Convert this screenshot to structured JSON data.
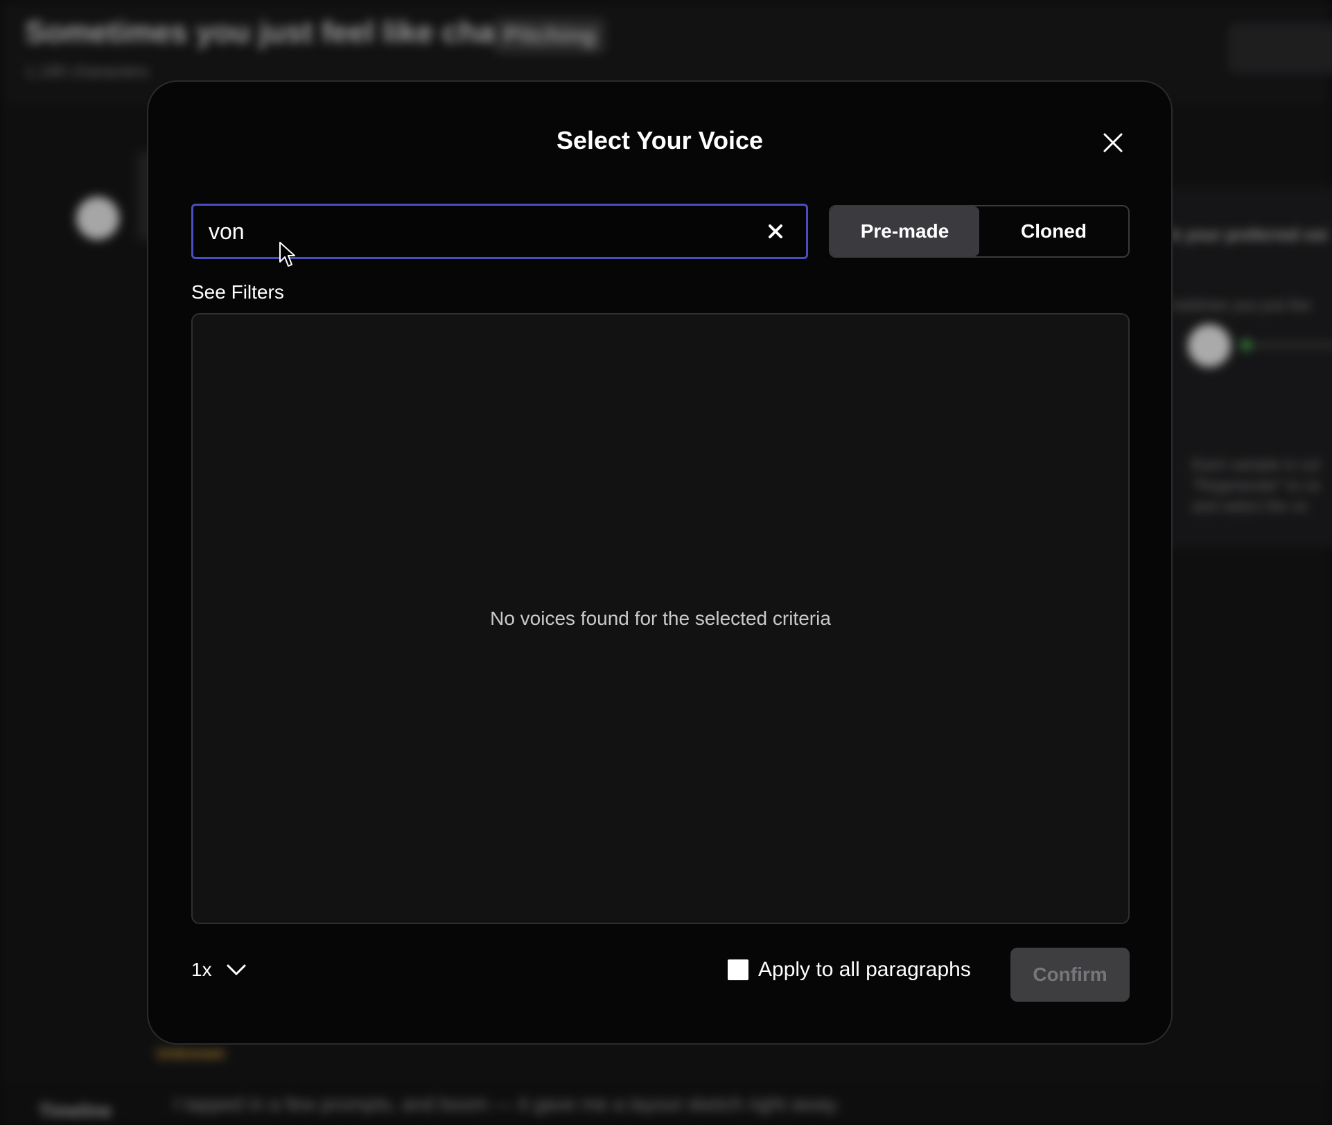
{
  "background": {
    "title": "Sometimes you just feel like cha...",
    "badge": "Pitching",
    "subtitle": "1,180 characters",
    "right_panel_title": "k your preferred voi",
    "right_panel_sub": "metimes you just fee",
    "right_panel_note": "Each sample is cut \"Regenerate\" to ca and select the vo",
    "unknown_label": "Unknown",
    "timeline_label": "Timeline",
    "bottom_text": "I tapped in a few prompts, and boom — it gave me a layout sketch right away."
  },
  "modal": {
    "title": "Select Your Voice",
    "search": {
      "value": "von",
      "placeholder": ""
    },
    "tabs": [
      {
        "label": "Pre-made",
        "active": true
      },
      {
        "label": "Cloned",
        "active": false
      }
    ],
    "see_filters_label": "See Filters",
    "empty_message": "No voices found for the selected criteria",
    "speed_value": "1x",
    "apply_all_label": "Apply to all paragraphs",
    "apply_all_checked": false,
    "confirm_label": "Confirm"
  },
  "colors": {
    "focus_border": "#4a4ec0",
    "modal_bg": "#060607",
    "active_tab": "#3b3b3f",
    "confirm_disabled_bg": "#3e3e41",
    "confirm_disabled_text": "#77777b"
  }
}
